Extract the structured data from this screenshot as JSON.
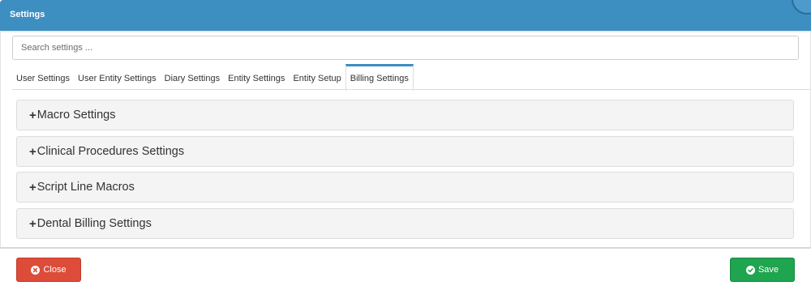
{
  "window": {
    "title": "Settings"
  },
  "search": {
    "placeholder": "Search settings ..."
  },
  "tabs": [
    {
      "label": "User Settings",
      "active": false
    },
    {
      "label": "User Entity Settings",
      "active": false
    },
    {
      "label": "Diary Settings",
      "active": false
    },
    {
      "label": "Entity Settings",
      "active": false
    },
    {
      "label": "Entity Setup",
      "active": false
    },
    {
      "label": "Billing Settings",
      "active": true
    }
  ],
  "sections": [
    {
      "expander": "+",
      "label": "Macro Settings"
    },
    {
      "expander": "+",
      "label": "Clinical Procedures Settings"
    },
    {
      "expander": "+",
      "label": "Script Line Macros"
    },
    {
      "expander": "+",
      "label": "Dental Billing Settings"
    }
  ],
  "footer": {
    "close_label": "Close",
    "save_label": "Save"
  },
  "icons": {
    "close": "close-circle-icon",
    "save": "check-circle-icon"
  },
  "colors": {
    "header": "#3d8ec1",
    "close_button": "#dd4b39",
    "save_button": "#1fa44f"
  }
}
